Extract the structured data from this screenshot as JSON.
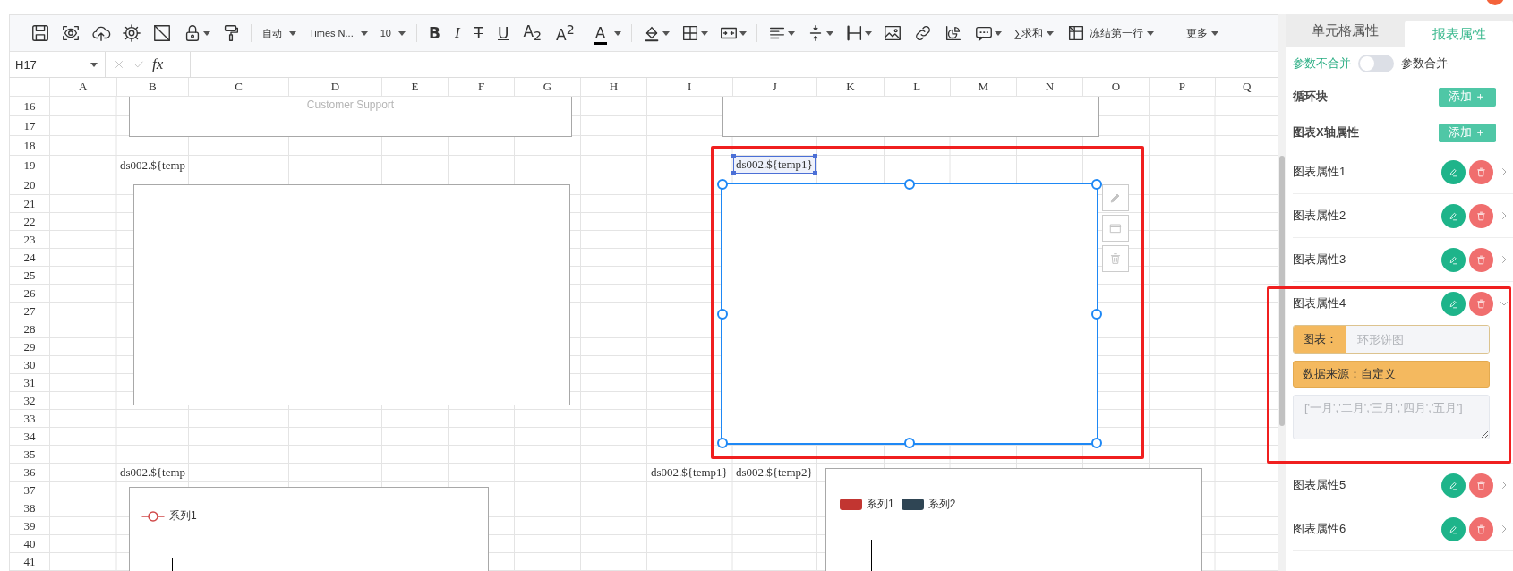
{
  "toolbar": {
    "font_format": "自动",
    "font_family": "Times N...",
    "font_size": "10",
    "bold": "B",
    "italic": "I",
    "strikethrough": "T",
    "underline": "U",
    "subscript": "A$_{2}$",
    "superscript": "A$^{2}$",
    "font_color": "A",
    "sum": "∑求和",
    "freeze": "冻结第一行",
    "more": "更多"
  },
  "formula_bar": {
    "cell": "H17",
    "fx": "fx"
  },
  "sheet": {
    "columns": [
      "A",
      "B",
      "C",
      "D",
      "E",
      "F",
      "G",
      "H",
      "I",
      "J",
      "K",
      "L",
      "M",
      "N",
      "O",
      "P",
      "Q"
    ],
    "rows": [
      "16",
      "17",
      "18",
      "19",
      "20",
      "21",
      "22",
      "23",
      "24",
      "25",
      "26",
      "27",
      "28",
      "29",
      "30",
      "31",
      "32",
      "33",
      "34",
      "35",
      "36",
      "37",
      "38",
      "39",
      "40",
      "41"
    ],
    "texts": [
      {
        "text": "ds002.${temp",
        "selected": false
      },
      {
        "text": "ds002.${temp1}",
        "selected": true
      },
      {
        "text": "ds002.${temp",
        "selected": false
      },
      {
        "text": "ds002.${temp1}",
        "selected": false
      },
      {
        "text": "ds002.${temp2}",
        "selected": false
      }
    ],
    "charts": [
      {
        "kind": "frame",
        "title": "Customer Support",
        "selected": false
      },
      {
        "kind": "frame",
        "selected": false
      },
      {
        "kind": "frame",
        "selected": false
      },
      {
        "kind": "frame",
        "selected": true
      },
      {
        "kind": "line",
        "selected": false,
        "legend": [
          {
            "label": "系列1",
            "color": "#d14a4a"
          }
        ]
      },
      {
        "kind": "bar",
        "selected": false,
        "legend": [
          {
            "label": "系列1",
            "color": "#c23531"
          },
          {
            "label": "系列2",
            "color": "#2f4554"
          }
        ]
      }
    ]
  },
  "panel": {
    "tabs": [
      {
        "label": "单元格属性",
        "selected": false
      },
      {
        "label": "报表属性",
        "selected": true
      }
    ],
    "merge_toggle": {
      "off_label": "参数不合并",
      "on_label": "参数合并",
      "on": false
    },
    "sections": [
      {
        "label": "循环块",
        "button": "添加 ＋"
      },
      {
        "label": "图表X轴属性",
        "button": "添加 ＋"
      }
    ],
    "chart_properties": [
      {
        "label": "图表属性1",
        "expanded": false
      },
      {
        "label": "图表属性2",
        "expanded": false
      },
      {
        "label": "图表属性3",
        "expanded": false
      },
      {
        "label": "图表属性4",
        "expanded": true,
        "chart_label": "图表：",
        "chart_placeholder": "环形饼图",
        "source": "数据来源：自定义",
        "data_placeholder": "['一月','二月','三月','四月','五月']"
      },
      {
        "label": "图表属性5",
        "expanded": false
      },
      {
        "label": "图表属性6",
        "expanded": false
      }
    ]
  }
}
